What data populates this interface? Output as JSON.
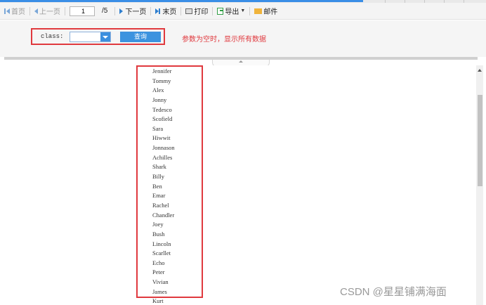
{
  "toolbar": {
    "first_page": "首页",
    "prev_page": "上一页",
    "page_value": "1",
    "total_pages": "/5",
    "next_page": "下一页",
    "last_page": "末页",
    "print": "打印",
    "export": "导出",
    "mail": "邮件"
  },
  "params": {
    "class_label": "class:",
    "class_value": "",
    "query_button": "查询",
    "note": "参数为空时，显示所有数据"
  },
  "names": [
    "Jennifer",
    "Tommy",
    "Alex",
    "Jonny",
    "Tedesco",
    "Scofield",
    "Sara",
    "Hiwwit",
    "Jonnason",
    "Achilles",
    "Shark",
    "Billy",
    "Ben",
    "Emar",
    "Rachel",
    "Chandler",
    "Joey",
    "Bush",
    "Lincoln",
    "Scarllet",
    "Echo",
    "Peter",
    "Vivian",
    "James",
    "Kurt"
  ],
  "watermark": "CSDN @星星铺满海面",
  "colors": {
    "accent": "#3c93df",
    "highlight": "#e0393e"
  }
}
